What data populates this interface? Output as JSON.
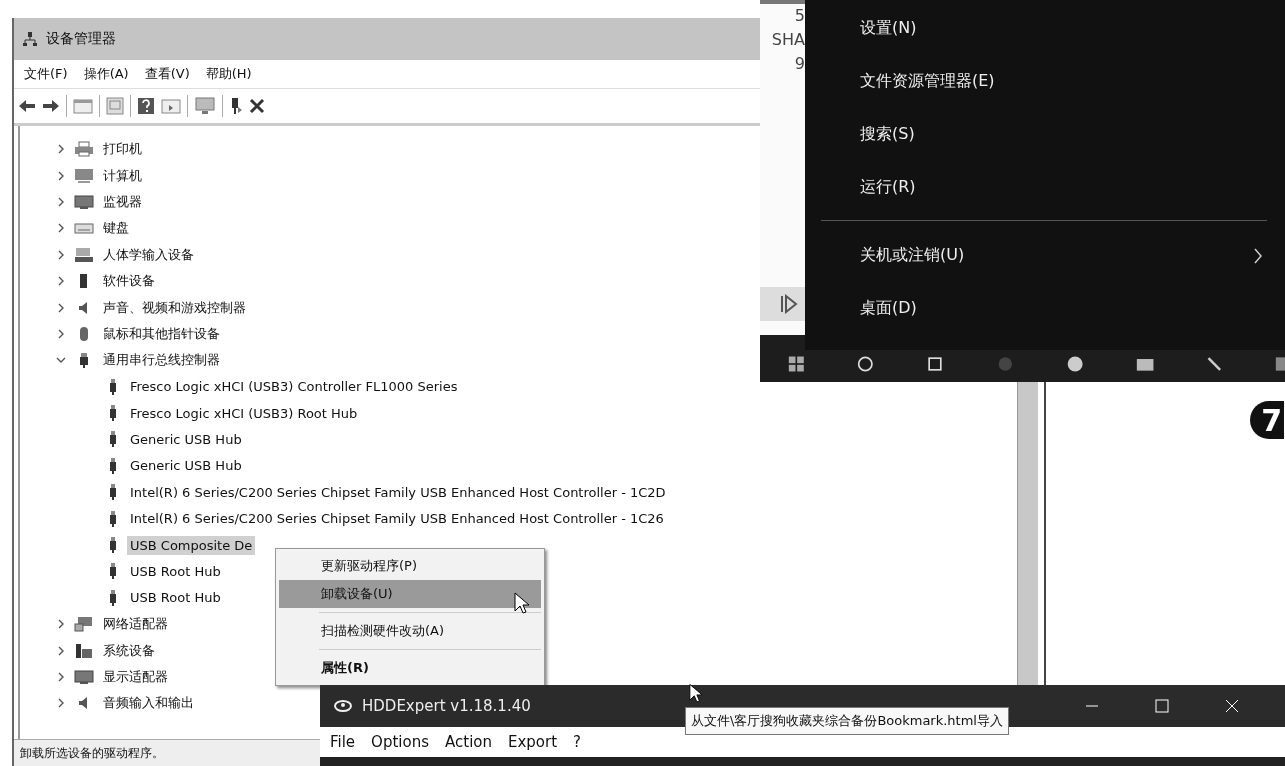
{
  "device_manager": {
    "title": "设备管理器",
    "menu": [
      "文件(F)",
      "操作(A)",
      "查看(V)",
      "帮助(H)"
    ],
    "tree": [
      {
        "label": "打印机",
        "expanded": false
      },
      {
        "label": "计算机",
        "expanded": false
      },
      {
        "label": "监视器",
        "expanded": false
      },
      {
        "label": "键盘",
        "expanded": false
      },
      {
        "label": "人体学输入设备",
        "expanded": false
      },
      {
        "label": "软件设备",
        "expanded": false
      },
      {
        "label": "声音、视频和游戏控制器",
        "expanded": false
      },
      {
        "label": "鼠标和其他指针设备",
        "expanded": false
      },
      {
        "label": "通用串行总线控制器",
        "expanded": true,
        "children": [
          {
            "label": "Fresco Logic xHCI (USB3) Controller FL1000 Series",
            "selected": false
          },
          {
            "label": "Fresco Logic xHCI (USB3) Root Hub",
            "selected": false
          },
          {
            "label": "Generic USB Hub",
            "selected": false
          },
          {
            "label": "Generic USB Hub",
            "selected": false
          },
          {
            "label": "Intel(R) 6 Series/C200 Series Chipset Family USB Enhanced Host Controller - 1C2D",
            "selected": false
          },
          {
            "label": "Intel(R) 6 Series/C200 Series Chipset Family USB Enhanced Host Controller - 1C26",
            "selected": false
          },
          {
            "label": "USB Composite De",
            "selected": true
          },
          {
            "label": "USB Root Hub",
            "selected": false
          },
          {
            "label": "USB Root Hub",
            "selected": false
          }
        ]
      },
      {
        "label": "网络适配器",
        "expanded": false
      },
      {
        "label": "系统设备",
        "expanded": false
      },
      {
        "label": "显示适配器",
        "expanded": false
      },
      {
        "label": "音频输入和输出",
        "expanded": false
      }
    ],
    "context_menu": [
      {
        "kind": "item",
        "label": "更新驱动程序(P)",
        "selected": false,
        "default": false
      },
      {
        "kind": "item",
        "label": "卸载设备(U)",
        "selected": true,
        "default": false
      },
      {
        "kind": "separator"
      },
      {
        "kind": "item",
        "label": "扫描检测硬件改动(A)",
        "selected": false,
        "default": false
      },
      {
        "kind": "separator"
      },
      {
        "kind": "item",
        "label": "属性(R)",
        "selected": false,
        "default": true
      }
    ],
    "status_bar": "卸载所选设备的驱动程序。"
  },
  "background_window": {
    "texts": [
      "5",
      "SHA",
      "9"
    ]
  },
  "start_context_menu": [
    {
      "kind": "item",
      "label": "设置(N)",
      "submenu": false
    },
    {
      "kind": "item",
      "label": "文件资源管理器(E)",
      "submenu": false
    },
    {
      "kind": "item",
      "label": "搜索(S)",
      "submenu": false
    },
    {
      "kind": "item",
      "label": "运行(R)",
      "submenu": false
    },
    {
      "kind": "separator"
    },
    {
      "kind": "item",
      "label": "关机或注销(U)",
      "submenu": true
    },
    {
      "kind": "item",
      "label": "桌面(D)",
      "submenu": false
    }
  ],
  "step_badge": "7",
  "hddexpert": {
    "title": "HDDExpert v1.18.1.40",
    "menu": [
      "File",
      "Options",
      "Action",
      "Export",
      "?"
    ],
    "tooltip": "从文件\\客厅搜狗收藏夹综合备份Bookmark.html导入"
  }
}
